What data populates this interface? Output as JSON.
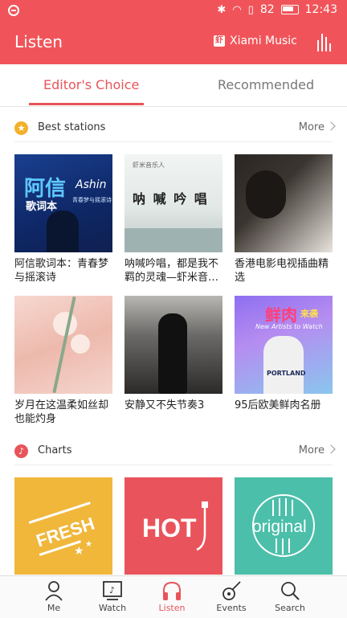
{
  "status_bar": {
    "battery": "82",
    "time": "12:43"
  },
  "app_bar": {
    "title": "Listen",
    "brand": "Xiami Music",
    "colors": {
      "primary": "#f0545a"
    }
  },
  "tabs": [
    {
      "label": "Editor's Choice",
      "active": true
    },
    {
      "label": "Recommended",
      "active": false
    }
  ],
  "best_stations": {
    "label": "Best stations",
    "more": "More",
    "items": [
      {
        "caption": "阿信歌词本：青春梦与摇滚诗",
        "cover_text": [
          "阿信",
          "歌词本",
          "Ashin",
          "青春梦与摇滚诗"
        ]
      },
      {
        "caption": "呐喊吟唱，都是我不羁的灵魂—虾米音…",
        "cover_text": [
          "虾米音乐人",
          "呐 喊 吟 唱"
        ]
      },
      {
        "caption": "香港电影电视插曲精选",
        "cover_text": []
      },
      {
        "caption": "岁月在这温柔如丝却也能灼身",
        "cover_text": []
      },
      {
        "caption": "安静又不失节奏3",
        "cover_text": []
      },
      {
        "caption": "95后欧美鲜肉名册",
        "cover_text": [
          "鲜肉",
          "来袭",
          "New Artists to Watch",
          "PORTLAND"
        ]
      }
    ]
  },
  "charts": {
    "label": "Charts",
    "more": "More",
    "items": [
      {
        "name": "FRESH",
        "color": "#f0b73b"
      },
      {
        "name": "HOT",
        "color": "#e9545c"
      },
      {
        "name": "original",
        "color": "#4bbfa9"
      }
    ]
  },
  "bottom_nav": [
    {
      "label": "Me",
      "icon": "person-icon",
      "active": false
    },
    {
      "label": "Watch",
      "icon": "tv-icon",
      "active": false
    },
    {
      "label": "Listen",
      "icon": "headphones-icon",
      "active": true
    },
    {
      "label": "Events",
      "icon": "guitar-icon",
      "active": false
    },
    {
      "label": "Search",
      "icon": "search-icon",
      "active": false
    }
  ]
}
